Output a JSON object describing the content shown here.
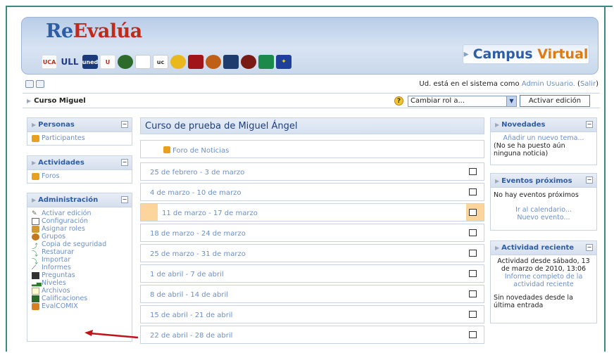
{
  "header": {
    "logo_part1": "Re",
    "logo_part2": "Evalúa",
    "campus_part1": "Campus",
    "campus_part2": "Virtual",
    "partner_logos": [
      "UCA",
      "ULL",
      "UNED",
      "U",
      "seal-1",
      "seal-2",
      "uc",
      "seal-3",
      "seal-4",
      "seal-5",
      "seal-6",
      "seal-7",
      "junta",
      "eu"
    ]
  },
  "top": {
    "user_prefix": "Ud. está en el sistema como",
    "user_name": "Admin Usuario.",
    "logout_open": "(",
    "logout_label": "Salir",
    "logout_close": ")"
  },
  "nav": {
    "breadcrumb": "Curso Miguel",
    "role_select_value": "Cambiar rol a...",
    "edit_button": "Activar edición"
  },
  "left": {
    "personas": {
      "title": "Personas",
      "items": [
        "Participantes"
      ]
    },
    "actividades": {
      "title": "Actividades",
      "items": [
        "Foros"
      ]
    },
    "administracion": {
      "title": "Administración",
      "items": [
        "Activar edición",
        "Configuración",
        "Asignar roles",
        "Grupos",
        "Copia de seguridad",
        "Restaurar",
        "Importar",
        "Informes",
        "Preguntas",
        "Niveles",
        "Archivos",
        "Calificaciones",
        "EvalCOMIX"
      ]
    }
  },
  "course": {
    "title": "Curso de prueba de Miguel Ángel",
    "news_forum": "Foro de Noticias",
    "weeks": [
      "25 de febrero - 3 de marzo",
      "4 de marzo - 10 de marzo",
      "11 de marzo - 17 de marzo",
      "18 de marzo - 24 de marzo",
      "25 de marzo - 31 de marzo",
      "1 de abril - 7 de abril",
      "8 de abril - 14 de abril",
      "15 de abril - 21 de abril",
      "22 de abril - 28 de abril"
    ],
    "current_week_index": 2
  },
  "right": {
    "novedades": {
      "title": "Novedades",
      "add_link": "Añadir un nuevo tema...",
      "empty": "(No se ha puesto aún ninguna noticia)"
    },
    "eventos": {
      "title": "Eventos próximos",
      "empty": "No hay eventos próximos",
      "calendar_link": "Ir al calendario...",
      "new_event_link": "Nuevo evento..."
    },
    "actividad": {
      "title": "Actividad reciente",
      "since": "Actividad desde sábado, 13 de marzo de 2010, 13:06",
      "report_link": "Informe completo de la actividad reciente",
      "none": "Sin novedades desde la última entrada"
    }
  },
  "colors": {
    "accent": "#2e5da8",
    "link": "#6b8fc8",
    "highlight": "#fbd59b",
    "frame": "#3a8a80",
    "arrow": "#c0141a"
  }
}
